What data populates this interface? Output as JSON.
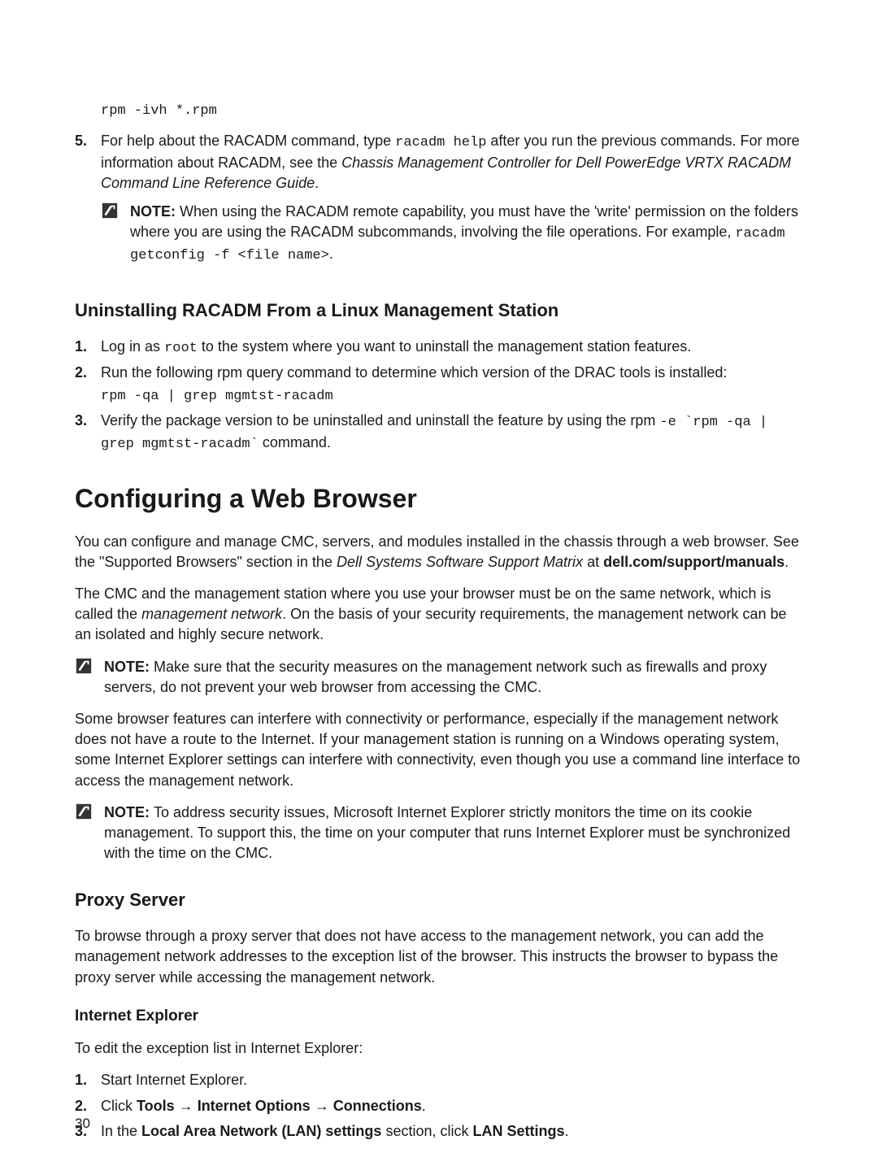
{
  "code_block_rpm": "rpm -ivh *.rpm",
  "step5": {
    "num": "5.",
    "text1": "For help about the RACADM command, type ",
    "code1": "racadm help",
    "text2": " after you run the previous commands. For more information about RACADM, see the ",
    "italic1": "Chassis Management Controller for Dell PowerEdge VRTX RACADM Command Line Reference Guide",
    "text3": "."
  },
  "note1": {
    "label": "NOTE: ",
    "text1": "When using the RACADM remote capability, you must have the 'write' permission on the folders where you are using the RACADM subcommands, involving the file operations. For example, ",
    "code1": "racadm getconfig -f <file name>",
    "text2": "."
  },
  "h3_uninstall": "Uninstalling RACADM From a Linux Management Station",
  "uninstall_steps": {
    "s1": {
      "num": "1.",
      "text1": "Log in as ",
      "code1": "root",
      "text2": " to the system where you want to uninstall the management station features."
    },
    "s2": {
      "num": "2.",
      "text1": "Run the following rpm query command to determine which version of the DRAC tools is installed:",
      "code1": "rpm -qa | grep mgmtst-racadm"
    },
    "s3": {
      "num": "3.",
      "text1": "Verify the package version to be uninstalled and uninstall the feature by using the rpm ",
      "code1": "-e `rpm -qa | grep mgmtst-racadm`",
      "text2": " command."
    }
  },
  "h2_config": "Configuring a Web Browser",
  "p1": {
    "text1": "You can configure and manage CMC, servers, and modules installed in the chassis through a web browser. See the \"Supported Browsers\" section in the ",
    "italic1": "Dell Systems Software Support Matrix",
    "text2": " at ",
    "bold1": "dell.com/support/manuals",
    "text3": "."
  },
  "p2": {
    "text1": "The CMC and the management station where you use your browser must be on the same network, which is called the ",
    "italic1": "management network",
    "text2": ". On the basis of your security requirements, the management network can be an isolated and highly secure network."
  },
  "note2": {
    "label": "NOTE: ",
    "text1": "Make sure that the security measures on the management network such as firewalls and proxy servers, do not prevent your web browser from accessing the CMC."
  },
  "p3": "Some browser features can interfere with connectivity or performance, especially if the management network does not have a route to the Internet. If your management station is running on a Windows operating system, some Internet Explorer settings can interfere with connectivity, even though you use a command line interface to access the management network.",
  "note3": {
    "label": "NOTE: ",
    "text1": "To address security issues, Microsoft Internet Explorer strictly monitors the time on its cookie management. To support this, the time on your computer that runs Internet Explorer must be synchronized with the time on the CMC."
  },
  "h3_proxy": "Proxy Server",
  "p4": "To browse through a proxy server that does not have access to the management network, you can add the management network addresses to the exception list of the browser. This instructs the browser to bypass the proxy server while accessing the management network.",
  "h4_ie": "Internet Explorer",
  "p5": "To edit the exception list in Internet Explorer:",
  "ie_steps": {
    "s1": {
      "num": "1.",
      "text1": "Start Internet Explorer."
    },
    "s2": {
      "num": "2.",
      "text1": "Click ",
      "bold1": "Tools",
      "arrow1": " → ",
      "bold2": "Internet Options",
      "arrow2": " → ",
      "bold3": "Connections",
      "text2": "."
    },
    "s3": {
      "num": "3.",
      "text1": "In the ",
      "bold1": "Local Area Network (LAN) settings",
      "text2": " section, click ",
      "bold2": "LAN Settings",
      "text3": "."
    }
  },
  "pagenum": "30"
}
